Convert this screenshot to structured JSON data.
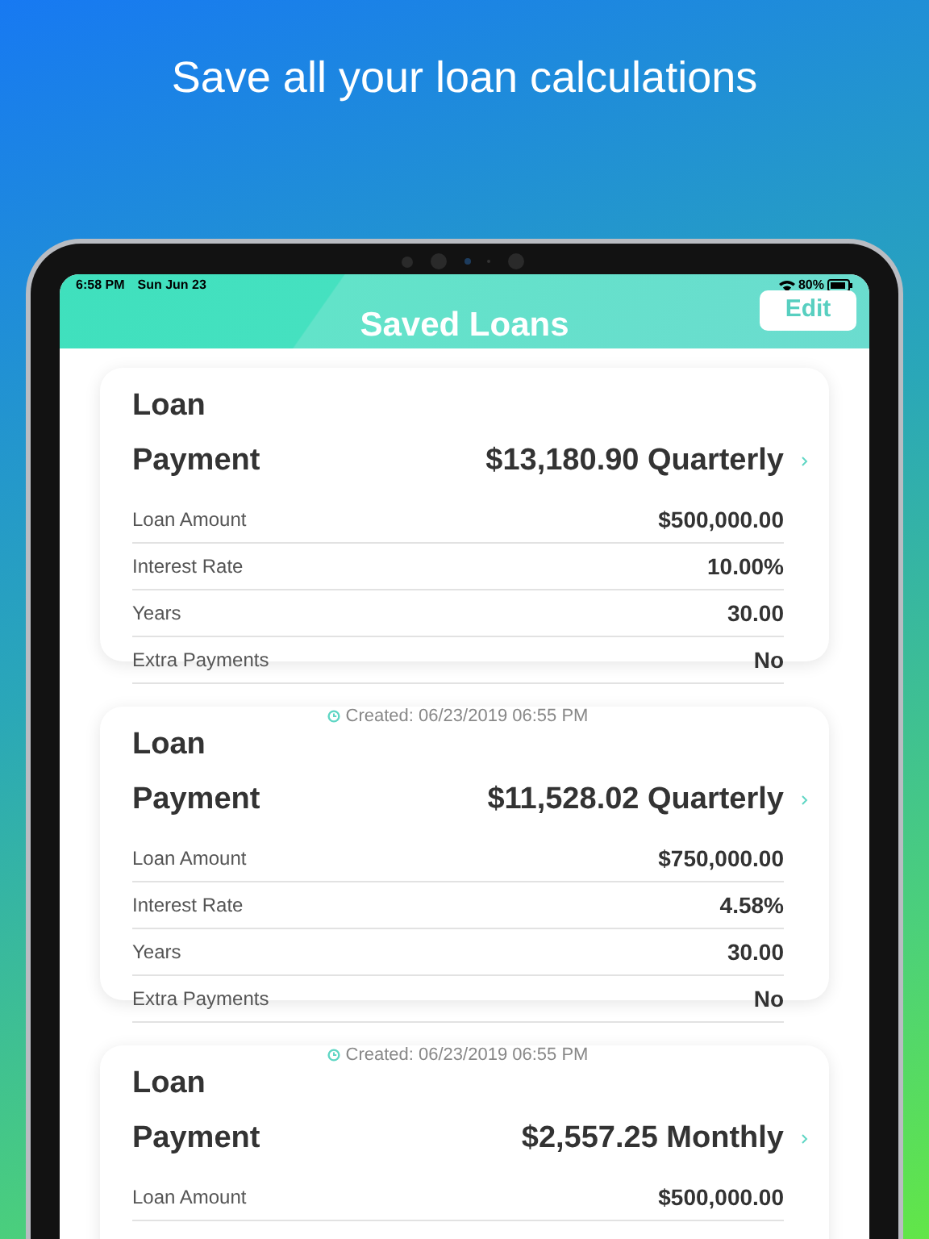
{
  "headline": "Save all your loan calculations",
  "status_bar": {
    "time": "6:58 PM",
    "date": "Sun Jun 23",
    "battery": "80%"
  },
  "nav": {
    "title": "Saved Loans",
    "edit_button": "Edit"
  },
  "loans": [
    {
      "title": "Loan",
      "payment_label": "Payment",
      "payment": "$13,180.90 Quarterly",
      "rows": [
        {
          "label": "Loan Amount",
          "value": "$500,000.00"
        },
        {
          "label": "Interest Rate",
          "value": "10.00%"
        },
        {
          "label": "Years",
          "value": "30.00"
        },
        {
          "label": "Extra Payments",
          "value": "No"
        }
      ]
    },
    {
      "created": "Created: 06/23/2019 06:55 PM",
      "title": "Loan",
      "payment_label": "Payment",
      "payment": "$11,528.02 Quarterly",
      "rows": [
        {
          "label": "Loan Amount",
          "value": "$750,000.00"
        },
        {
          "label": "Interest Rate",
          "value": "4.58%"
        },
        {
          "label": "Years",
          "value": "30.00"
        },
        {
          "label": "Extra Payments",
          "value": "No"
        }
      ]
    },
    {
      "created": "Created: 06/23/2019 06:55 PM",
      "title": "Loan",
      "payment_label": "Payment",
      "payment": "$2,557.25 Monthly",
      "rows": [
        {
          "label": "Loan Amount",
          "value": "$500,000.00"
        }
      ]
    }
  ]
}
